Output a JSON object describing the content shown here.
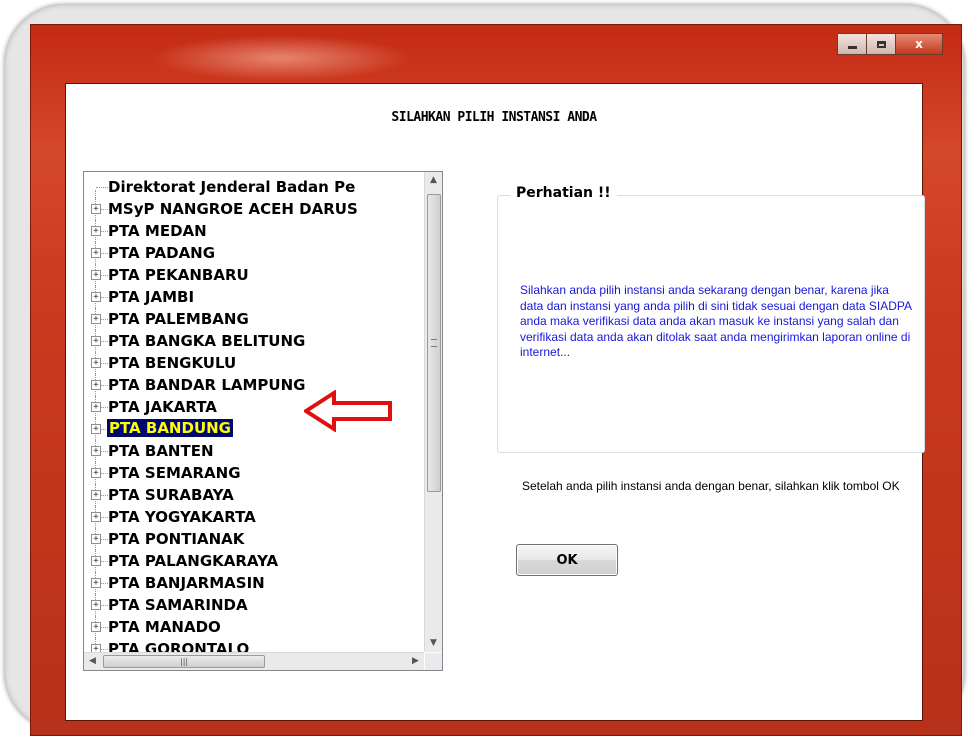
{
  "window": {
    "controls": {
      "minimize_icon": "minimize-icon",
      "maximize_icon": "maximize-icon",
      "close_glyph": "x"
    }
  },
  "dialog": {
    "heading": "SILAHKAN PILIH INSTANSI ANDA",
    "tree": {
      "root_label": "Direktorat Jenderal Badan Pe",
      "items": [
        {
          "label": "MSyP NANGROE ACEH DARUS",
          "selected": false
        },
        {
          "label": "PTA MEDAN",
          "selected": false
        },
        {
          "label": "PTA PADANG",
          "selected": false
        },
        {
          "label": "PTA PEKANBARU",
          "selected": false
        },
        {
          "label": "PTA JAMBI",
          "selected": false
        },
        {
          "label": "PTA PALEMBANG",
          "selected": false
        },
        {
          "label": "PTA BANGKA BELITUNG",
          "selected": false
        },
        {
          "label": "PTA BENGKULU",
          "selected": false
        },
        {
          "label": "PTA BANDAR LAMPUNG",
          "selected": false
        },
        {
          "label": "PTA JAKARTA",
          "selected": false
        },
        {
          "label": "PTA BANDUNG",
          "selected": true
        },
        {
          "label": "PTA BANTEN",
          "selected": false
        },
        {
          "label": "PTA SEMARANG",
          "selected": false
        },
        {
          "label": "PTA SURABAYA",
          "selected": false
        },
        {
          "label": "PTA YOGYAKARTA",
          "selected": false
        },
        {
          "label": "PTA PONTIANAK",
          "selected": false
        },
        {
          "label": "PTA PALANGKARAYA",
          "selected": false
        },
        {
          "label": "PTA BANJARMASIN",
          "selected": false
        },
        {
          "label": "PTA SAMARINDA",
          "selected": false
        },
        {
          "label": "PTA MANADO",
          "selected": false
        },
        {
          "label": "PTA GORONTALO",
          "selected": false
        }
      ],
      "expander_glyph": "+"
    },
    "notice": {
      "title": "Perhatian !!",
      "text": "Silahkan anda pilih instansi anda sekarang dengan benar, karena jika data dan instansi yang anda pilih di sini tidak sesuai dengan data SIADPA anda maka verifikasi data anda akan masuk ke instansi yang salah dan verifikasi data anda akan ditolak saat anda mengirimkan laporan online di internet..."
    },
    "instruction": "Setelah anda pilih instansi anda dengan benar, silahkan klik tombol OK",
    "ok_button": "OK"
  },
  "colors": {
    "titlebar": "#c42a14",
    "selection_bg": "#000a6e",
    "selection_fg": "#ffff00",
    "notice_text": "#1818d8",
    "arrow": "#e01010"
  }
}
